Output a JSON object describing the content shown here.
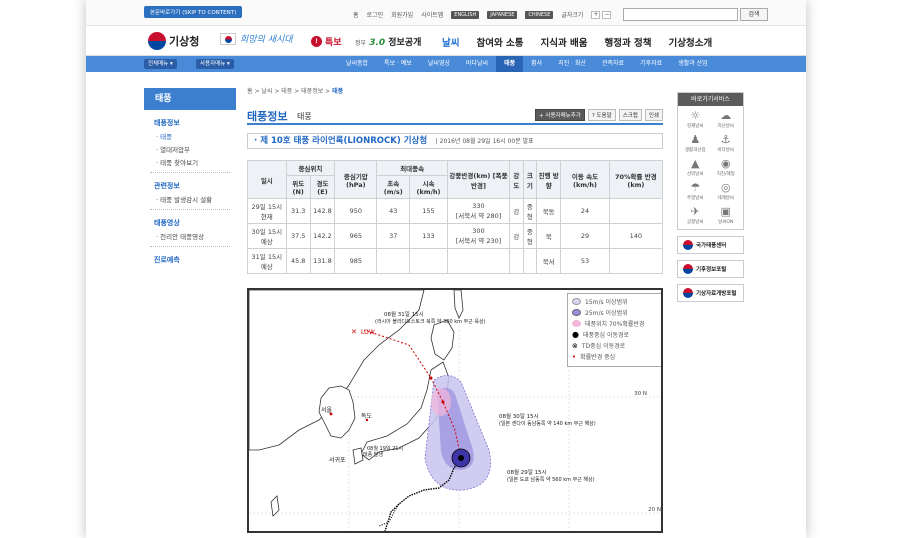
{
  "util": {
    "skip": "본문바로가기 (SKIP TO CONTENT)",
    "links": [
      "홈",
      "로그인",
      "회원가입",
      "사이트맵"
    ],
    "langs": [
      "ENGLISH",
      "JAPANESE",
      "CHINESE"
    ],
    "font_label": "글자크기",
    "font_plus": "+",
    "font_minus": "−",
    "search_button": "검색"
  },
  "gnb": {
    "logo": "기상청",
    "slogan": "희망의 새시대",
    "tokbo": "특보",
    "gov_small": "정부",
    "gov_num": "3.0",
    "gov_text": "정보공개",
    "menu": [
      "날씨",
      "참여와 소통",
      "지식과 배움",
      "행정과 정책",
      "기상청소개"
    ]
  },
  "subnav": {
    "left": [
      "전체메뉴 ▾",
      "사용자메뉴 ▾"
    ],
    "items": [
      "날씨종합",
      "특보 · 예보",
      "날씨영상",
      "바다날씨",
      "태풍",
      "황사",
      "지진 · 화산",
      "관측자료",
      "기후자료",
      "생활과 산업"
    ],
    "active": "태풍"
  },
  "lnb": {
    "title": "태풍",
    "s1": "태풍정보",
    "s1_items": [
      "· 태풍",
      "· 열대저압부",
      "· 태풍 찾아보기"
    ],
    "s2": "관련정보",
    "s2_items": [
      "· 태풍 발생감시 설황"
    ],
    "s3": "태풍영상",
    "s3_items": [
      "· 천리안 태풍영상"
    ],
    "s4": "진로예측"
  },
  "content": {
    "breadcrumb": [
      "홈",
      "날씨",
      "태풍",
      "태풍정보"
    ],
    "breadcrumb_current": "태풍",
    "title": "태풍정보",
    "subtitle": "태풍",
    "tools": [
      "+ 사용자메뉴추가",
      "? 도움말",
      "스크랩",
      "인쇄"
    ],
    "storm_name": "· 제 10호 태풍 라이언록(LIONROCK) 기상청",
    "storm_date": "| 2016년 08월 29일 16시 00분 발표"
  },
  "table": {
    "h_time": "일시",
    "h_center": "중심위치",
    "h_lat": "위도(N)",
    "h_lon": "경도(E)",
    "h_pressure": "중심기압 (hPa)",
    "h_maxwind": "최대풍속",
    "h_ms": "초속 (m/s)",
    "h_kmh": "시속 (km/h)",
    "h_radius": "강풍반경(km) [폭풍반경]",
    "h_strength": "강도",
    "h_size": "크기",
    "h_dir": "진행 방향",
    "h_speed": "이동 속도 (km/h)",
    "h_prob": "70%확률 반경 (km)",
    "rows": [
      {
        "time": "29일 15시 현재",
        "lat": "31.3",
        "lon": "142.8",
        "pres": "950",
        "ms": "43",
        "kmh": "155",
        "rad": "330",
        "rad2": "[서북서 약 280]",
        "str": "강",
        "size": "중형",
        "dir": "북동",
        "spd": "24",
        "prob": ""
      },
      {
        "time": "30일 15시 예상",
        "lat": "37.5",
        "lon": "142.2",
        "pres": "965",
        "ms": "37",
        "kmh": "133",
        "rad": "300",
        "rad2": "[서북서 약 230]",
        "str": "강",
        "size": "중형",
        "dir": "북",
        "spd": "29",
        "prob": "140"
      },
      {
        "time": "31일 15시 예상",
        "lat": "45.8",
        "lon": "131.8",
        "pres": "985",
        "ms": "",
        "kmh": "",
        "rad": "",
        "rad2": "",
        "str": "",
        "size": "",
        "dir": "북서",
        "spd": "53",
        "prob": ""
      }
    ]
  },
  "map": {
    "legend": [
      "15m/s 이상범위",
      "25m/s 이상범위",
      "태풍위치 70%확률반경",
      "태풍중심 이동경로",
      "TD중심 이동경로",
      "확률반경 중심"
    ],
    "label_31": "08월 31일 15시",
    "label_31b": "(러시아 블라디보스토크 북쪽 약 300 km 부근 육상)",
    "label_30": "08월 30일 15시",
    "label_30b": "(일본 센다이 동남동쪽 약 140 km 부근 해상)",
    "label_29": "08월 29일 15시",
    "label_29b": "(일본 도쿄 남동쪽 약 560 km 부근 해상)",
    "label_19": "08월 19일 21시",
    "label_19b": "태풍 발생",
    "low": "LOW",
    "seoul": "서울",
    "dokdo": "독도",
    "seogwipo": "서귀포",
    "lat30": "30 N",
    "lat20": "20 N"
  },
  "rside": {
    "title": "바로가기서비스",
    "items": [
      "현재날씨",
      "지난날씨",
      "생활과산업",
      "바다날씨",
      "산악날씨",
      "지진/해일",
      "주말날씨",
      "세계날씨",
      "공항날씨",
      "날씨ON"
    ],
    "banners": [
      "국가태풍센터",
      "기후정보포털",
      "기상자료개방포털"
    ]
  }
}
